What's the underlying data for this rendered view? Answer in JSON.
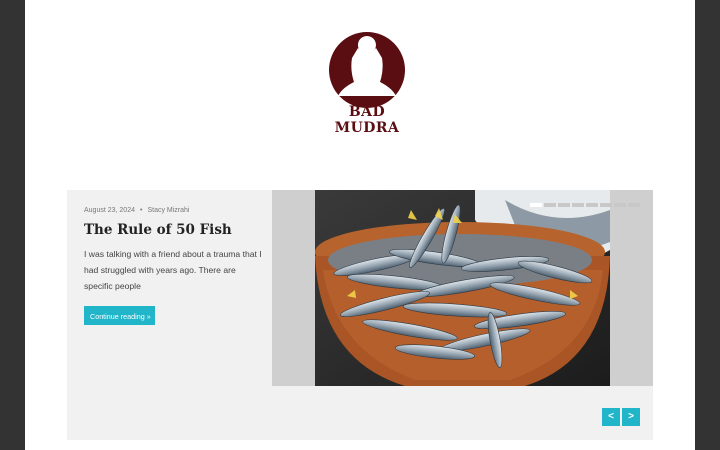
{
  "site": {
    "logo_text": "BAD MUDRA",
    "brand_color": "#5a0e12"
  },
  "post": {
    "date": "August 23, 2024",
    "separator": "•",
    "author": "Stacy Mizrahi",
    "title": "The Rule of 50 Fish",
    "excerpt": "I was talking with a friend about a trauma that I had struggled with years ago. There are specific people",
    "read_more": "Continue reading »"
  },
  "slider": {
    "slide_count": 8,
    "active_slide": 1,
    "prev_label": "<",
    "next_label": ">",
    "image_subject": "bowl of fresh fish"
  },
  "colors": {
    "accent": "#20b5c8",
    "page_bg": "#333333",
    "slider_bg": "#f1f1f1"
  }
}
